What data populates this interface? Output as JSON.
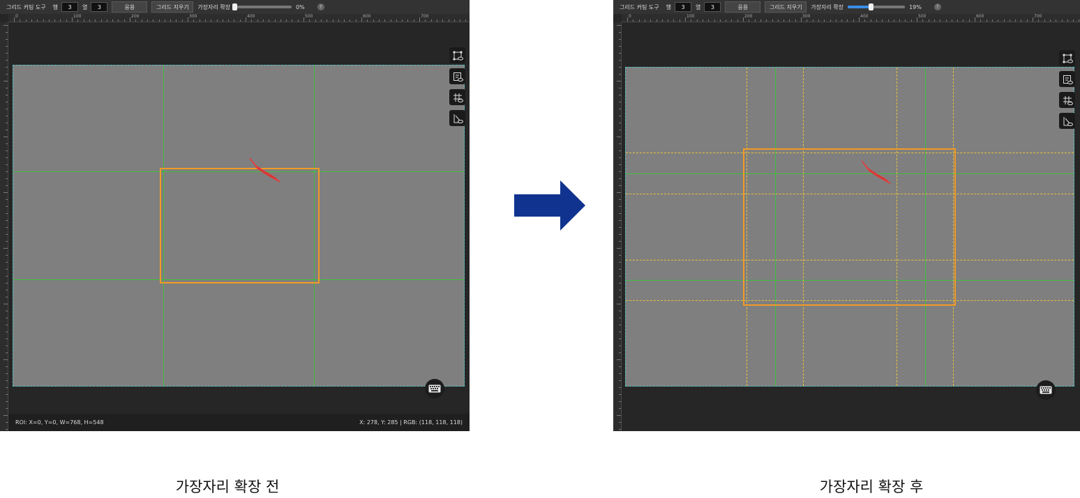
{
  "panels": {
    "before": {
      "toolbar": {
        "title": "그리드 커팅 도구",
        "rows_label": "행",
        "rows_value": "3",
        "cols_label": "열",
        "cols_value": "3",
        "apply_label": "응용",
        "clear_label": "그리드 지우기",
        "margin_label": "가장자리 확장",
        "margin_value": 0,
        "margin_text": "0%",
        "help": "?"
      },
      "ruler_labels": [
        "0",
        "100",
        "200",
        "300",
        "400",
        "500",
        "600",
        "700"
      ],
      "status": {
        "roi": "ROI: X=0, Y=0, W=768, H=548",
        "pixel": "X: 278, Y: 285 | RGB: (118, 118, 118)"
      }
    },
    "after": {
      "toolbar": {
        "title": "그리드 커팅 도구",
        "rows_label": "행",
        "rows_value": "3",
        "cols_label": "열",
        "cols_value": "3",
        "apply_label": "응용",
        "clear_label": "그리드 지우기",
        "margin_label": "가장자리 확장",
        "margin_value": 19,
        "margin_text": "19%",
        "help": "?"
      },
      "ruler_labels": [
        "0",
        "100",
        "200",
        "300",
        "400",
        "500",
        "600",
        "700"
      ]
    }
  },
  "icons": [
    "roi-view-icon",
    "report-icon",
    "grid-view-icon",
    "edit-view-icon",
    "keyboard-icon"
  ],
  "colors": {
    "grid": "#3fbf3f",
    "margin_grid": "#e8c23a",
    "roi": "#f39a24",
    "defect": "#d03030",
    "arrow": "#10338f",
    "slider": "#3a8ee6"
  },
  "captions": {
    "before": "가장자리 확장 전",
    "after": "가장자리 확장 후"
  }
}
